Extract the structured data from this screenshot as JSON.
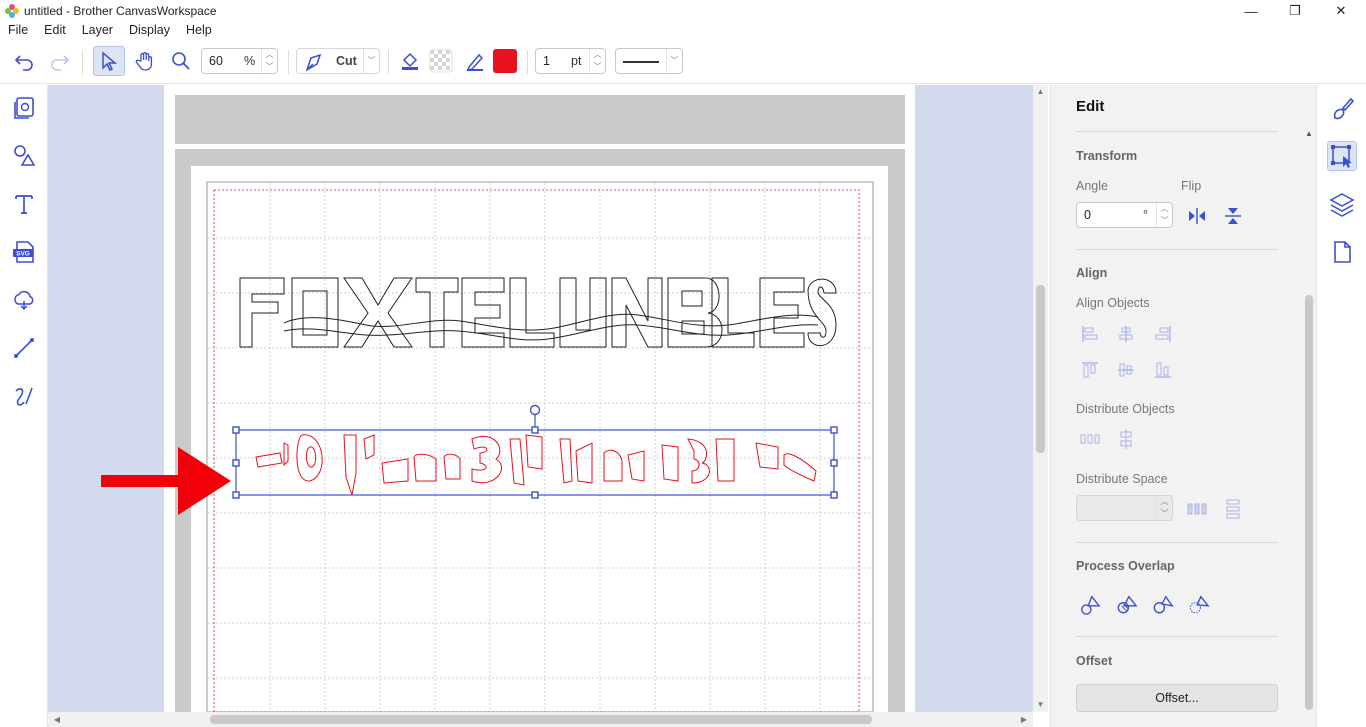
{
  "window": {
    "title": "untitled - Brother CanvasWorkspace",
    "minimize": "—",
    "restore": "❐",
    "close": "✕"
  },
  "menu": [
    "File",
    "Edit",
    "Layer",
    "Display",
    "Help"
  ],
  "toolbar": {
    "zoom_value": "60",
    "zoom_unit": "%",
    "mode_label": "Cut",
    "line_width_value": "1",
    "line_width_unit": "pt",
    "line_color": "#e8121f"
  },
  "left_tools": [
    "pages-icon",
    "shapes-icon",
    "text-icon",
    "svg-icon",
    "cloud-icon",
    "line-icon",
    "freehand-icon"
  ],
  "panel": {
    "title": "Edit",
    "transform_heading": "Transform",
    "angle_label": "Angle",
    "angle_value": "0",
    "angle_unit": "°",
    "flip_label": "Flip",
    "align_heading": "Align",
    "align_objects_label": "Align Objects",
    "distribute_objects_label": "Distribute Objects",
    "distribute_space_label": "Distribute Space",
    "process_overlap_heading": "Process Overlap",
    "offset_heading": "Offset",
    "offset_button": "Offset..."
  },
  "colors": {
    "accent": "#3b4fd0",
    "cut_line": "#e8121f",
    "canvas_bg": "#d3daee"
  }
}
